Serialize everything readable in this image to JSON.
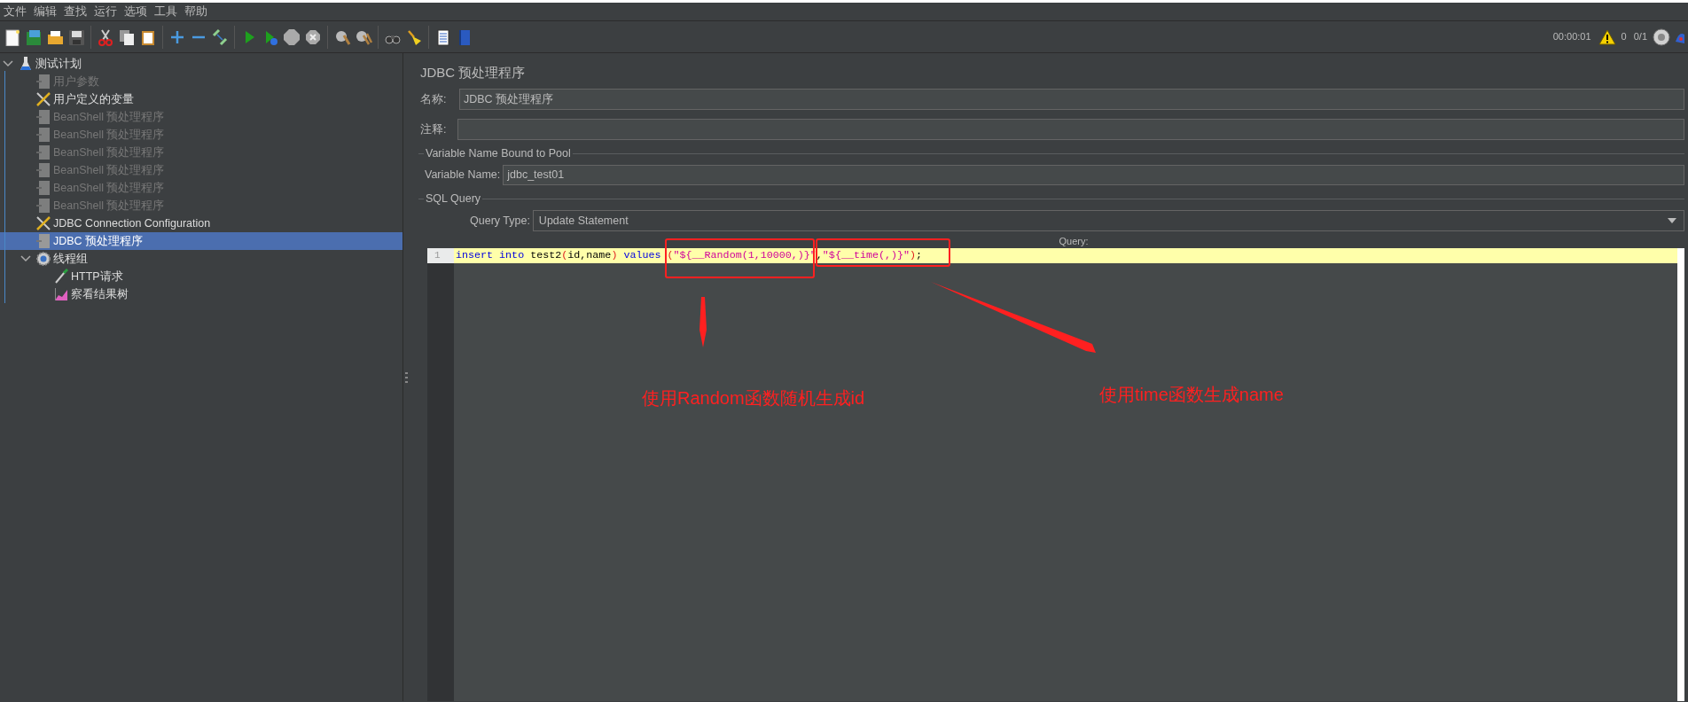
{
  "menu": [
    "文件",
    "编辑",
    "查找",
    "运行",
    "选项",
    "工具",
    "帮助"
  ],
  "status": {
    "elapsed": "00:00:01",
    "warnings": "0",
    "threads": "0/1"
  },
  "tree": [
    {
      "label": "测试计划",
      "kind": "plan",
      "expanded": true,
      "disabled": false,
      "selected": false,
      "children": [
        {
          "label": "用户参数",
          "kind": "pre",
          "disabled": true,
          "selected": false
        },
        {
          "label": "用户定义的变量",
          "kind": "config",
          "disabled": false,
          "selected": false
        },
        {
          "label": "BeanShell 预处理程序",
          "kind": "pre",
          "disabled": true,
          "selected": false
        },
        {
          "label": "BeanShell 预处理程序",
          "kind": "pre",
          "disabled": true,
          "selected": false
        },
        {
          "label": "BeanShell 预处理程序",
          "kind": "pre",
          "disabled": true,
          "selected": false
        },
        {
          "label": "BeanShell 预处理程序",
          "kind": "pre",
          "disabled": true,
          "selected": false
        },
        {
          "label": "BeanShell 预处理程序",
          "kind": "pre",
          "disabled": true,
          "selected": false
        },
        {
          "label": "BeanShell 预处理程序",
          "kind": "pre",
          "disabled": true,
          "selected": false
        },
        {
          "label": "JDBC Connection Configuration",
          "kind": "config",
          "disabled": false,
          "selected": false
        },
        {
          "label": "JDBC 预处理程序",
          "kind": "pre",
          "disabled": false,
          "selected": true
        },
        {
          "label": "线程组",
          "kind": "threads",
          "expanded": true,
          "disabled": false,
          "selected": false,
          "children": [
            {
              "label": "HTTP请求",
              "kind": "sampler",
              "disabled": false,
              "selected": false
            },
            {
              "label": "察看结果树",
              "kind": "listener",
              "disabled": false,
              "selected": false
            }
          ]
        }
      ]
    }
  ],
  "panel": {
    "title": "JDBC 预处理程序",
    "name_label": "名称:",
    "name_value": "JDBC 预处理程序",
    "comment_label": "注释:",
    "pool_section": "Variable Name Bound to Pool",
    "variable_label": "Variable Name:",
    "variable_value": "jdbc_test01",
    "sql_section": "SQL Query",
    "query_type_label": "Query Type:",
    "query_type_value": "Update Statement",
    "query_label": "Query:",
    "line_number": "1",
    "code": [
      {
        "text": "insert into",
        "kind": "keyword"
      },
      {
        "text": " test2",
        "kind": "plain"
      },
      {
        "text": "(",
        "kind": "paren"
      },
      {
        "text": "id,name",
        "kind": "plain"
      },
      {
        "text": ")",
        "kind": "paren"
      },
      {
        "text": " values ",
        "kind": "keyword"
      },
      {
        "text": "(",
        "kind": "paren"
      },
      {
        "text": "\"${__Random(1,10000,)}\"",
        "kind": "string"
      },
      {
        "text": ",",
        "kind": "plain"
      },
      {
        "text": "\"${__time(,)}\"",
        "kind": "string"
      },
      {
        "text": ")",
        "kind": "paren"
      },
      {
        "text": ";",
        "kind": "plain"
      }
    ]
  },
  "annotations": [
    {
      "text": "使用Random函数随机生成id"
    },
    {
      "text": "使用time函数生成name"
    }
  ]
}
